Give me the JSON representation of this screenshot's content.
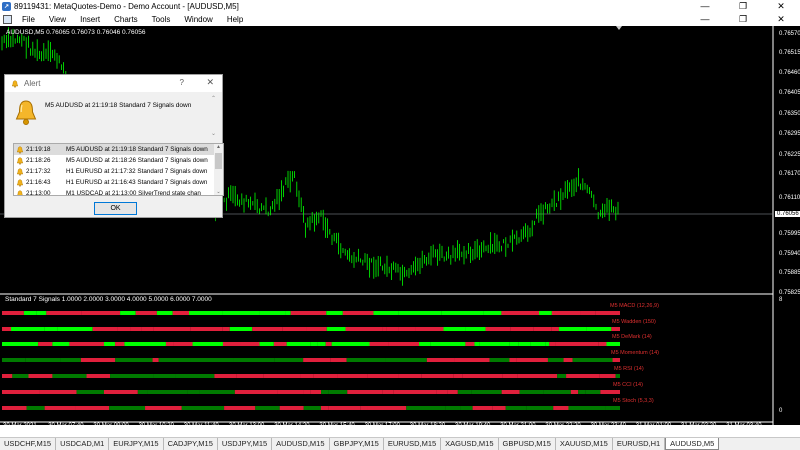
{
  "window": {
    "title": "89119431: MetaQuotes-Demo - Demo Account - [AUDUSD,M5]",
    "controls": [
      "—",
      "❐",
      "✕"
    ]
  },
  "menu": {
    "items": [
      "File",
      "View",
      "Insert",
      "Charts",
      "Tools",
      "Window",
      "Help"
    ],
    "mdi_controls": [
      "—",
      "❐",
      "✕"
    ]
  },
  "chart": {
    "info": "AUDUSD,M5  0.76065 0.76073 0.76046 0.76056",
    "price_labels": [
      "0.76570",
      "0.76515",
      "0.76460",
      "0.76405",
      "0.76350",
      "0.76295",
      "0.76225",
      "0.76170",
      "0.76110",
      "0.75995",
      "0.75940",
      "0.75885",
      "0.75825"
    ],
    "current_price": "0.76056",
    "time_labels": [
      "30 Mar 2021",
      "30 Mar 07:40",
      "30 Mar 09:00",
      "30 Mar 10:20",
      "30 Mar 11:40",
      "30 Mar 13:00",
      "30 Mar 14:20",
      "30 Mar 15:40",
      "30 Mar 17:00",
      "30 Mar 18:20",
      "30 Mar 19:40",
      "30 Mar 21:00",
      "30 Mar 22:20",
      "30 Mar 23:40",
      "31 Mar 01:00",
      "31 Mar 02:20",
      "31 Mar 03:40"
    ],
    "colors": {
      "background": "#000000",
      "candles": "#00ff00",
      "bullish": "#00ff00",
      "bearish": "#e0203c",
      "dark_green": "#007a00"
    }
  },
  "indicator": {
    "title": "Standard 7 Signals 1.0000 2.0000 3.0000 4.0000 5.0000 6.0000 7.0000",
    "scale_top": "8",
    "scale_bottom": "0",
    "signals": [
      "M5 MACD (12,26,9)",
      "M5 Wadden (150)",
      "M5 DeMark (14)",
      "M5 Momentum (14)",
      "M5 RSI (14)",
      "M5 CCI (14)",
      "M5 Stoch (5,3,3)"
    ]
  },
  "alert": {
    "title": "Alert",
    "help": "?",
    "close": "✕",
    "message": "M5 AUDUSD at 21:19:18 Standard 7 Signals  down",
    "rows": [
      {
        "time": "21:19:18",
        "text": "M5 AUDUSD at 21:19:18 Standard 7 Signals   down"
      },
      {
        "time": "21:18:26",
        "text": "M5 AUDUSD at 21:18:26 Standard 7 Signals   down"
      },
      {
        "time": "21:17:32",
        "text": "H1 EURUSD at 21:17:32 Standard 7 Signals   down"
      },
      {
        "time": "21:16:43",
        "text": "H1 EURUSD at 21:16:43 Standard 7 Signals   down"
      },
      {
        "time": "21:13:00",
        "text": "M1 USDCAD at 21:13:00 SilverTrend state chan"
      }
    ],
    "ok_label": "OK"
  },
  "tabs": {
    "items": [
      "USDCHF,M15",
      "USDCAD,M1",
      "EURJPY,M15",
      "CADJPY,M15",
      "USDJPY,M15",
      "AUDUSD,M15",
      "GBPJPY,M15",
      "EURUSD,M15",
      "XAGUSD,M15",
      "GBPUSD,M15",
      "XAUUSD,M15",
      "EURUSD,H1",
      "AUDUSD,M5"
    ],
    "active": "AUDUSD,M5"
  }
}
